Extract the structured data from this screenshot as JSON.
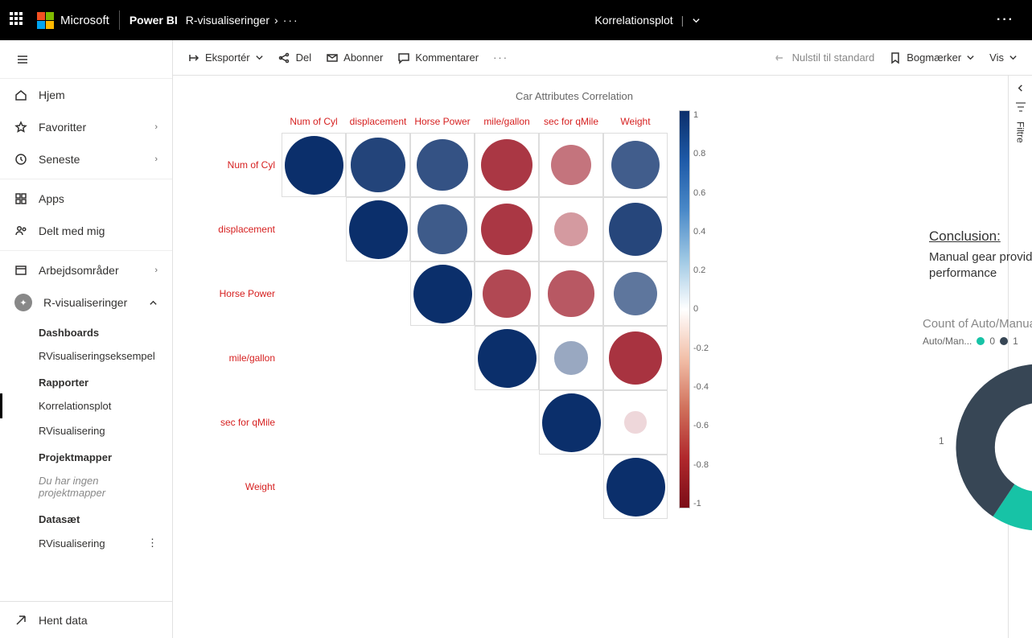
{
  "topbar": {
    "brand": "Microsoft",
    "product": "Power BI",
    "breadcrumb": "R-visualiseringer",
    "report_title": "Korrelationsplot"
  },
  "sidebar": {
    "home": "Hjem",
    "favorites": "Favoritter",
    "recent": "Seneste",
    "apps": "Apps",
    "shared": "Delt med mig",
    "workspaces": "Arbejdsområder",
    "current_ws": "R-visualiseringer",
    "sections": {
      "dashboards": "Dashboards",
      "reports": "Rapporter",
      "workbooks": "Projektmapper",
      "datasets": "Datasæt"
    },
    "items": {
      "dash1": "RVisualiseringseksempel",
      "report1": "Korrelationsplot",
      "report2": "RVisualisering",
      "no_workbooks": "Du har ingen projektmapper",
      "dataset1": "RVisualisering"
    },
    "get_data": "Hent data"
  },
  "toolbar": {
    "export": "Eksportér",
    "share": "Del",
    "subscribe": "Abonner",
    "comments": "Kommentarer",
    "reset": "Nulstil til standard",
    "bookmarks": "Bogmærker",
    "view": "Vis"
  },
  "conclusion": {
    "heading": "Conclusion:",
    "text": "Manual gear provides better performance"
  },
  "filters": {
    "label": "Filtre"
  },
  "chart_data": [
    {
      "type": "heatmap",
      "title": "Car Attributes Correlation",
      "variables": [
        "Num of Cyl",
        "displacement",
        "Horse Power",
        "mile/gallon",
        "sec for qMile",
        "Weight"
      ],
      "matrix": [
        [
          1.0,
          0.9,
          0.83,
          -0.85,
          -0.59,
          0.78
        ],
        [
          null,
          1.0,
          0.79,
          -0.85,
          -0.43,
          0.89
        ],
        [
          null,
          null,
          1.0,
          -0.78,
          -0.71,
          0.66
        ],
        [
          null,
          null,
          null,
          1.0,
          0.42,
          -0.87
        ],
        [
          null,
          null,
          null,
          null,
          1.0,
          -0.17
        ],
        [
          null,
          null,
          null,
          null,
          null,
          1.0
        ]
      ],
      "colorbar_ticks": [
        "1",
        "0.8",
        "0.6",
        "0.4",
        "0.2",
        "0",
        "-0.2",
        "-0.4",
        "-0.6",
        "-0.8",
        "-1"
      ],
      "scale": [
        -1,
        1
      ]
    },
    {
      "type": "pie",
      "title": "Count of Auto/Manual",
      "legend_label": "Auto/Man...",
      "series": [
        {
          "name": "0",
          "value": 19,
          "color": "#17c3a6"
        },
        {
          "name": "1",
          "value": 13,
          "color": "#374655"
        }
      ]
    }
  ]
}
